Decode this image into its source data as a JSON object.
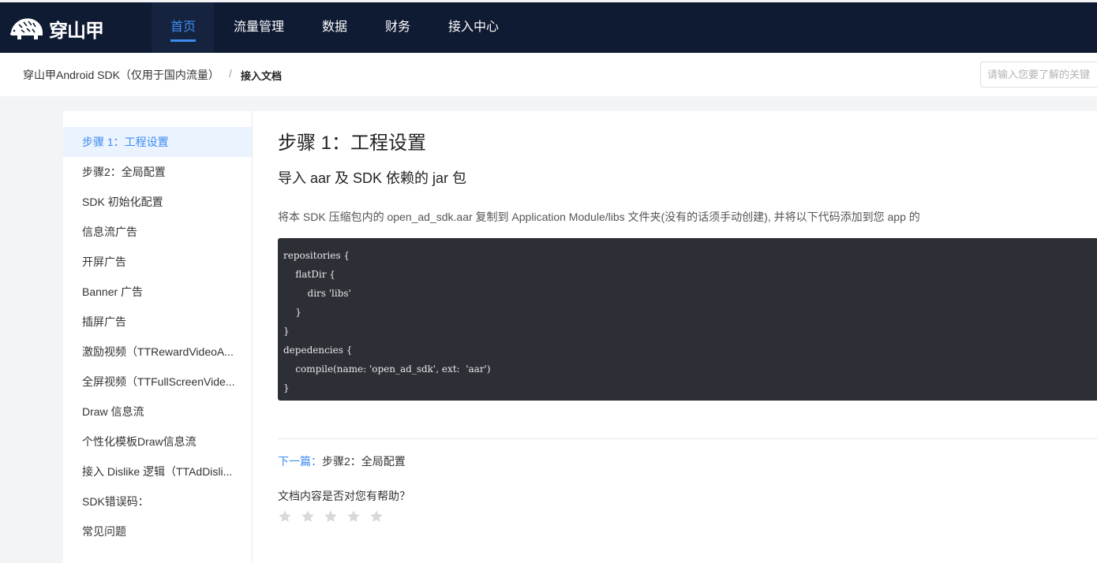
{
  "brand": {
    "name": "穿山甲"
  },
  "nav": {
    "items": [
      {
        "label": "首页",
        "active": true
      },
      {
        "label": "流量管理",
        "active": false
      },
      {
        "label": "数据",
        "active": false
      },
      {
        "label": "财务",
        "active": false
      },
      {
        "label": "接入中心",
        "active": false
      }
    ]
  },
  "breadcrumb": {
    "parent": "穿山甲Android SDK（仅用于国内流量）",
    "separator": "/",
    "current": "接入文档"
  },
  "search": {
    "placeholder": "请输入您要了解的关键"
  },
  "sidebar": {
    "items": [
      {
        "label": "步骤 1：工程设置",
        "active": true
      },
      {
        "label": "步骤2：全局配置",
        "active": false
      },
      {
        "label": "SDK 初始化配置",
        "active": false
      },
      {
        "label": "信息流广告",
        "active": false
      },
      {
        "label": "开屏广告",
        "active": false
      },
      {
        "label": "Banner 广告",
        "active": false
      },
      {
        "label": "插屏广告",
        "active": false
      },
      {
        "label": "激励视频（TTRewardVideoA...",
        "active": false
      },
      {
        "label": "全屏视频（TTFullScreenVide...",
        "active": false
      },
      {
        "label": "Draw 信息流",
        "active": false
      },
      {
        "label": "个性化模板Draw信息流",
        "active": false
      },
      {
        "label": "接入 Dislike 逻辑（TTAdDisli...",
        "active": false
      },
      {
        "label": "SDK错误码：",
        "active": false
      },
      {
        "label": "常见问题",
        "active": false
      }
    ]
  },
  "content": {
    "title": "步骤 1：工程设置",
    "subtitle": "导入 aar 及 SDK 依赖的 jar 包",
    "paragraph": "将本 SDK 压缩包内的 open_ad_sdk.aar 复制到 Application Module/libs 文件夹(没有的话须手动创建), 并将以下代码添加到您 app 的",
    "code_lines": [
      "repositories {",
      "    flatDir {",
      "        dirs 'libs'",
      "    }",
      "}",
      "depedencies {",
      "    compile(name: 'open_ad_sdk', ext:  'aar')",
      "}"
    ],
    "next_label": "下一篇：",
    "next_link": "步骤2：全局配置",
    "helpful_question": "文档内容是否对您有帮助？",
    "rating": {
      "value": 0,
      "max": 5
    }
  },
  "colors": {
    "nav_bg": "#0f1a33",
    "accent": "#3d8bf2",
    "code_bg": "#2d2f36",
    "star_empty": "#d9d9d9"
  }
}
